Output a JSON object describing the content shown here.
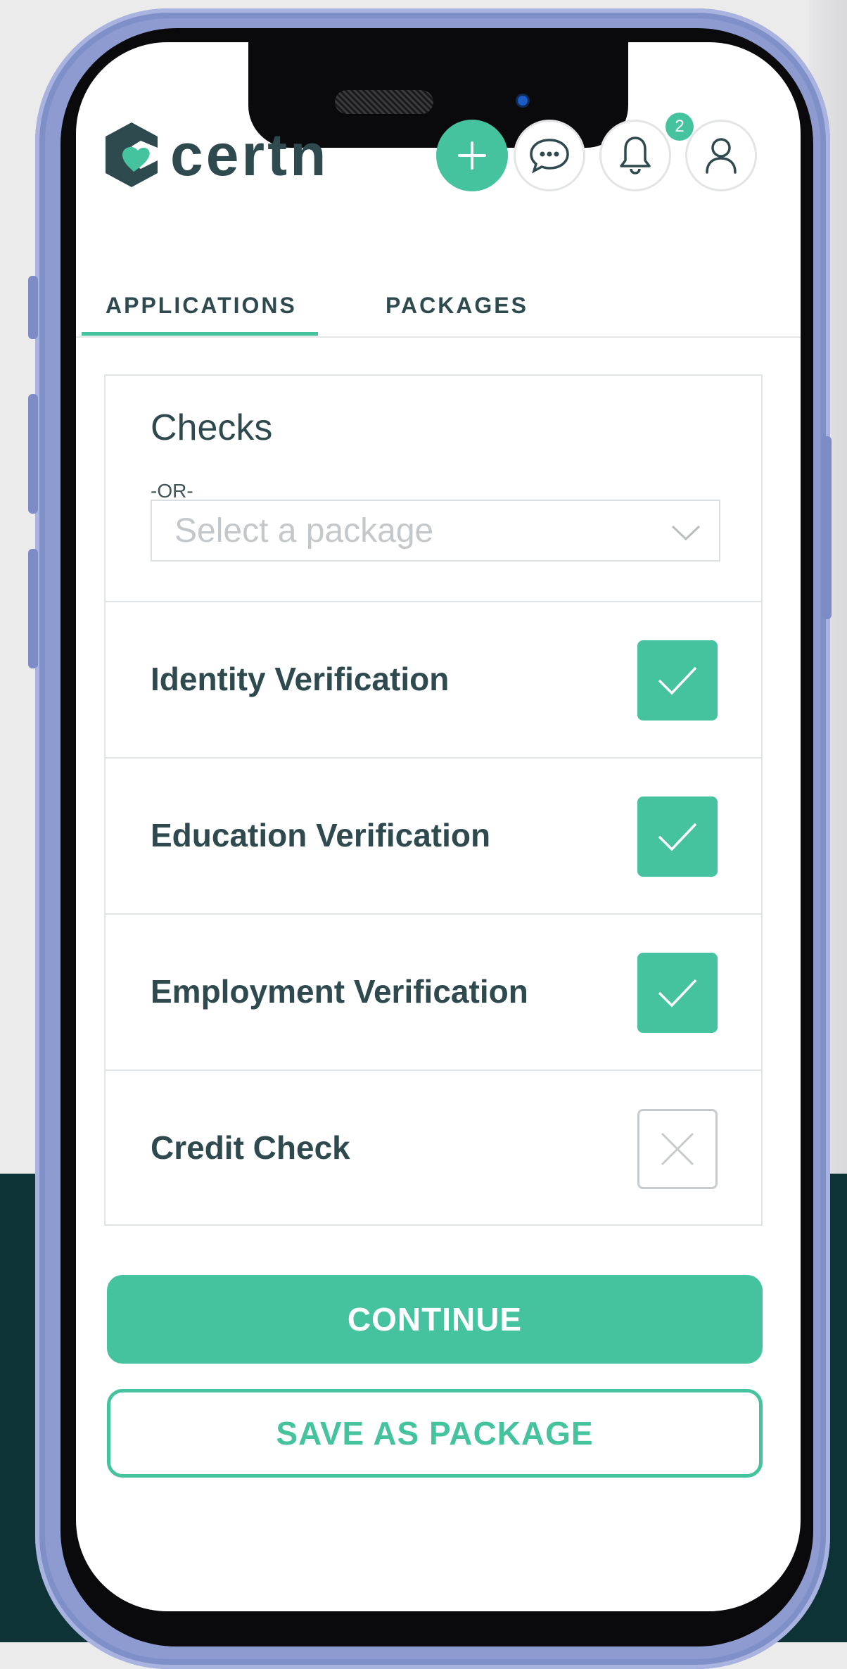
{
  "app": {
    "logo_text": "certn",
    "brand_color": "#45c39f",
    "text_color": "#2f4a4e"
  },
  "header": {
    "add_icon": "plus-icon",
    "messages_icon": "chat-icon",
    "notifications_icon": "bell-icon",
    "notifications_count": "2",
    "profile_icon": "user-icon"
  },
  "tabs": [
    {
      "label": "APPLICATIONS",
      "active": true
    },
    {
      "label": "PACKAGES",
      "active": false
    }
  ],
  "checks_card": {
    "title": "Checks",
    "or_text": "-OR-",
    "package_select": {
      "placeholder": "Select a package",
      "value": ""
    }
  },
  "checks": [
    {
      "label": "Identity Verification",
      "checked": true
    },
    {
      "label": "Education Verification",
      "checked": true
    },
    {
      "label": "Employment Verification",
      "checked": true
    },
    {
      "label": "Credit Check",
      "checked": false
    }
  ],
  "actions": {
    "continue_label": "CONTINUE",
    "save_package_label": "SAVE AS PACKAGE"
  }
}
